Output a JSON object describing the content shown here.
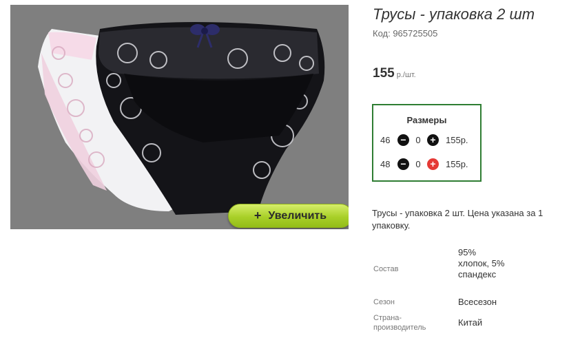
{
  "product": {
    "title": "Трусы - упаковка 2 шт",
    "code": "Код: 965725505",
    "price": "155",
    "price_unit": " р./шт.",
    "zoom_label": "Увеличить",
    "zoom_plus": "+",
    "description": "Трусы - упаковка 2 шт. Цена указана за 1 упаковку."
  },
  "sizes": {
    "title": "Размеры",
    "rows": [
      {
        "size": "46",
        "qty": "0",
        "price": "155р."
      },
      {
        "size": "48",
        "qty": "0",
        "price": "155р."
      }
    ]
  },
  "attributes": [
    {
      "label": "Состав",
      "value": "95% хлопок, 5% спандекс"
    },
    {
      "label": "Сезон",
      "value": "Всесезон"
    },
    {
      "label": "Страна-производитель",
      "value": "Китай"
    }
  ],
  "colors": {
    "accent_green": "#2e7d32",
    "button_green": "#a9d029",
    "plus_red": "#e53935"
  },
  "icons": {
    "minus": "minus-circle-icon",
    "plus": "plus-circle-icon"
  }
}
